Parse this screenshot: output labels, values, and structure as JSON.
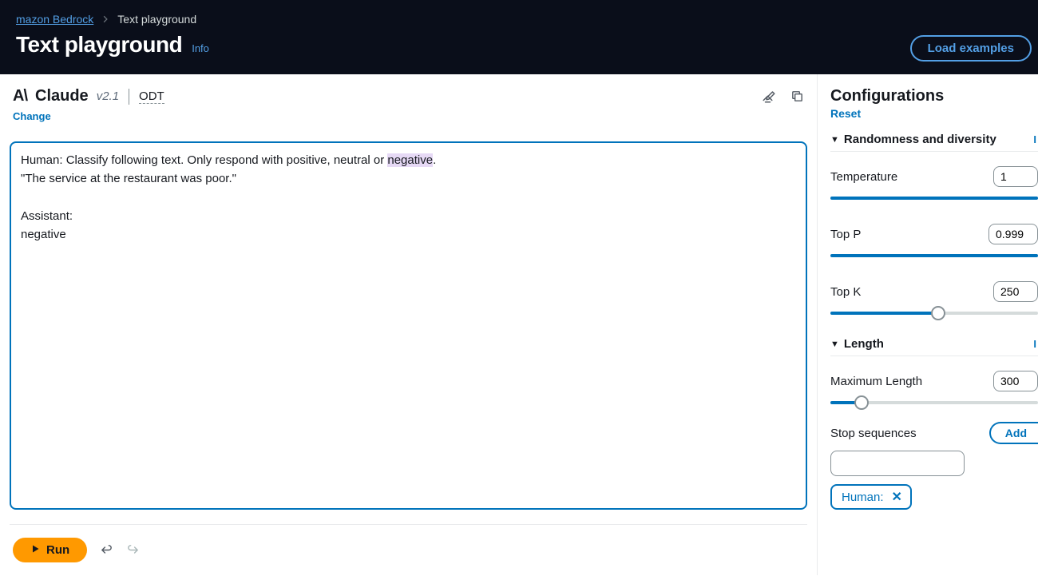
{
  "breadcrumb": {
    "root": "mazon Bedrock",
    "current": "Text playground"
  },
  "header": {
    "title": "Text playground",
    "info": "Info",
    "load_examples": "Load examples"
  },
  "model": {
    "logo": "A\\",
    "name": "Claude",
    "version": "v2.1",
    "odt": "ODT",
    "change": "Change"
  },
  "editor": {
    "line1_pre": "Human: Classify following text. Only respond with positive, neutral or ",
    "line1_hl": "negative",
    "line1_post": ".",
    "line2": "\"The service at the restaurant was poor.\"",
    "line3": "Assistant:",
    "line4": "negative"
  },
  "actions": {
    "run": "Run"
  },
  "config": {
    "title": "Configurations",
    "reset": "Reset",
    "sections": {
      "randomness": "Randomness and diversity",
      "length": "Length"
    },
    "temperature": {
      "label": "Temperature",
      "value": "1",
      "fill_pct": 100,
      "thumb_pct": 111
    },
    "top_p": {
      "label": "Top P",
      "value": "0.999",
      "fill_pct": 100,
      "thumb_pct": 111
    },
    "top_k": {
      "label": "Top K",
      "value": "250",
      "fill_pct": 52,
      "thumb_pct": 52
    },
    "max_len": {
      "label": "Maximum Length",
      "value": "300",
      "fill_pct": 15,
      "thumb_pct": 15
    },
    "stop": {
      "label": "Stop sequences",
      "add": "Add",
      "tag": "Human:"
    }
  }
}
